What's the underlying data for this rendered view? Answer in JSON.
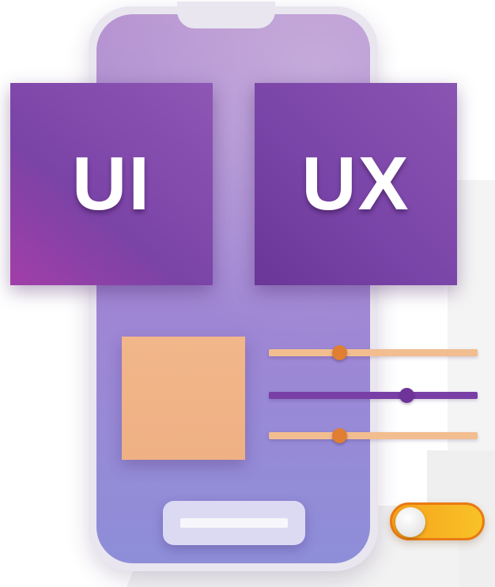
{
  "tiles": {
    "ui_label": "UI",
    "ux_label": "UX"
  },
  "sliders": [
    {
      "color": "#f2bd8f",
      "knob_color": "#e07e33",
      "value_pct": 34
    },
    {
      "color": "#7a3fa6",
      "knob_color": "#6e3498",
      "value_pct": 66
    },
    {
      "color": "#f2bd8f",
      "knob_color": "#e07e33",
      "value_pct": 34
    }
  ],
  "toggle": {
    "state": "off",
    "on_color": "#f8c227"
  },
  "colors": {
    "tile_purple": "#7a45a8",
    "card_peach": "#f1b689",
    "screen_lavender": "#a98ad2"
  }
}
